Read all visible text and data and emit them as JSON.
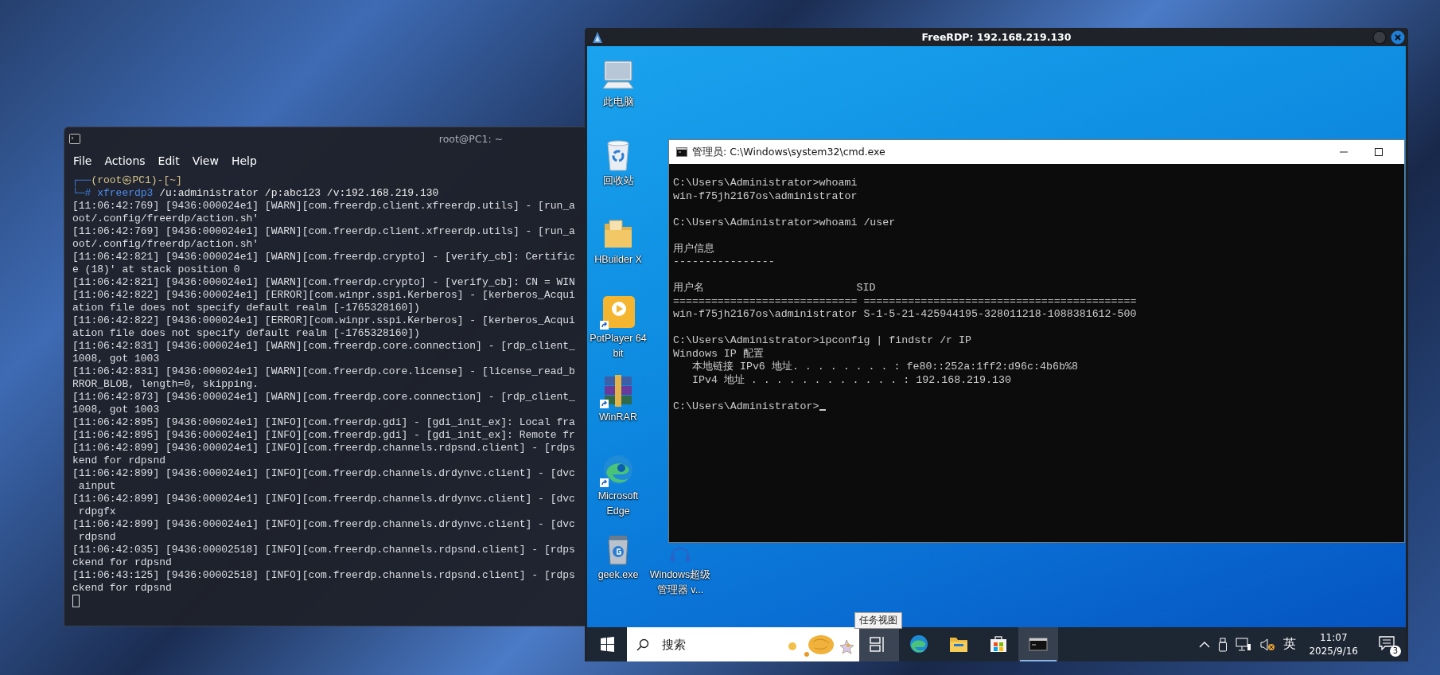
{
  "terminal": {
    "title": "root@PC1: ~",
    "menu": [
      {
        "label": "File"
      },
      {
        "label": "Actions"
      },
      {
        "label": "Edit"
      },
      {
        "label": "View"
      },
      {
        "label": "Help"
      }
    ],
    "prompt": [
      {
        "text": "┌──",
        "kind": "frame"
      },
      {
        "text": "(root㉿PC1)-[~]",
        "kind": "host"
      }
    ],
    "command": [
      {
        "text": "└─#",
        "kind": "frame"
      },
      {
        "text": " xfreerdp3",
        "kind": "program"
      },
      {
        "text": " /u:administrator /p:abc123 /v:192.168.219.130",
        "kind": "args"
      }
    ],
    "lines": [
      "[11:06:42:769] [9436:000024e1] [WARN][com.freerdp.client.xfreerdp.utils] - [run_a",
      "oot/.config/freerdp/action.sh'",
      "[11:06:42:769] [9436:000024e1] [WARN][com.freerdp.client.xfreerdp.utils] - [run_a",
      "oot/.config/freerdp/action.sh'",
      "[11:06:42:821] [9436:000024e1] [WARN][com.freerdp.crypto] - [verify_cb]: Certific",
      "e (18)' at stack position 0",
      "[11:06:42:821] [9436:000024e1] [WARN][com.freerdp.crypto] - [verify_cb]: CN = WIN",
      "[11:06:42:822] [9436:000024e1] [ERROR][com.winpr.sspi.Kerberos] - [kerberos_Acqui",
      "ation file does not specify default realm [-1765328160])",
      "[11:06:42:822] [9436:000024e1] [ERROR][com.winpr.sspi.Kerberos] - [kerberos_Acqui",
      "ation file does not specify default realm [-1765328160])",
      "[11:06:42:831] [9436:000024e1] [WARN][com.freerdp.core.connection] - [rdp_client_",
      "1008, got 1003",
      "[11:06:42:831] [9436:000024e1] [WARN][com.freerdp.core.license] - [license_read_b",
      "RROR_BLOB, length=0, skipping.",
      "[11:06:42:873] [9436:000024e1] [WARN][com.freerdp.core.connection] - [rdp_client_",
      "1008, got 1003",
      "[11:06:42:895] [9436:000024e1] [INFO][com.freerdp.gdi] - [gdi_init_ex]: Local fra",
      "[11:06:42:895] [9436:000024e1] [INFO][com.freerdp.gdi] - [gdi_init_ex]: Remote fr",
      "[11:06:42:899] [9436:000024e1] [INFO][com.freerdp.channels.rdpsnd.client] - [rdps",
      "kend for rdpsnd",
      "[11:06:42:899] [9436:000024e1] [INFO][com.freerdp.channels.drdynvc.client] - [dvc",
      " ainput",
      "[11:06:42:899] [9436:000024e1] [INFO][com.freerdp.channels.drdynvc.client] - [dvc",
      " rdpgfx",
      "[11:06:42:899] [9436:000024e1] [INFO][com.freerdp.channels.drdynvc.client] - [dvc",
      " rdpsnd",
      "[11:06:42:035] [9436:00002518] [INFO][com.freerdp.channels.rdpsnd.client] - [rdps",
      "ckend for rdpsnd",
      "[11:06:43:125] [9436:00002518] [INFO][com.freerdp.channels.rdpsnd.client] - [rdps",
      "ckend for rdpsnd"
    ]
  },
  "rdp_window": {
    "title": "FreeRDP: 192.168.219.130",
    "desktop_icons": [
      {
        "label": "此电脑",
        "kind": "computer",
        "shortcut": false
      },
      {
        "label": "回收站",
        "kind": "recycle-bin",
        "shortcut": false
      },
      {
        "label": "HBuilder X",
        "kind": "folder",
        "shortcut": false
      },
      {
        "label": "PotPlayer 64 bit",
        "kind": "player",
        "shortcut": true
      },
      {
        "label": "WinRAR",
        "kind": "archive",
        "shortcut": true
      },
      {
        "label": "Microsoft Edge",
        "kind": "edge",
        "shortcut": true
      },
      {
        "label": "geek.exe",
        "kind": "trash-can",
        "shortcut": false
      },
      {
        "label": "Windows超级管理器 v...",
        "kind": "headphones",
        "shortcut": false
      }
    ],
    "cmd": {
      "title": "管理员: C:\\Windows\\system32\\cmd.exe",
      "blocks": [
        [
          "C:\\Users\\Administrator>whoami",
          "win-f75jh2167os\\administrator"
        ],
        [
          "C:\\Users\\Administrator>whoami /user"
        ],
        [
          "用户信息",
          "----------------"
        ],
        [
          "用户名                        SID",
          "============================= ===========================================",
          "win-f75jh2167os\\administrator S-1-5-21-425944195-328011218-1088381612-500"
        ],
        [
          "C:\\Users\\Administrator>ipconfig | findstr /r IP",
          "Windows IP 配置",
          "   本地链接 IPv6 地址. . . . . . . . : fe80::252a:1ff2:d96c:4b6b%8",
          "   IPv4 地址 . . . . . . . . . . . . : 192.168.219.130"
        ],
        [
          "C:\\Users\\Administrator>"
        ]
      ]
    },
    "tooltip": "任务视图",
    "taskbar": {
      "search_placeholder": "搜索",
      "apps": [
        {
          "kind": "task-view",
          "selected": false,
          "hovered": true
        },
        {
          "kind": "edge",
          "selected": false,
          "hovered": false
        },
        {
          "kind": "explorer",
          "selected": false,
          "hovered": false
        },
        {
          "kind": "store",
          "selected": false,
          "hovered": false
        },
        {
          "kind": "cmd",
          "selected": true,
          "hovered": false
        }
      ],
      "ime": "英",
      "time": "11:07",
      "date": "2025/9/16",
      "notifications": "3"
    }
  }
}
